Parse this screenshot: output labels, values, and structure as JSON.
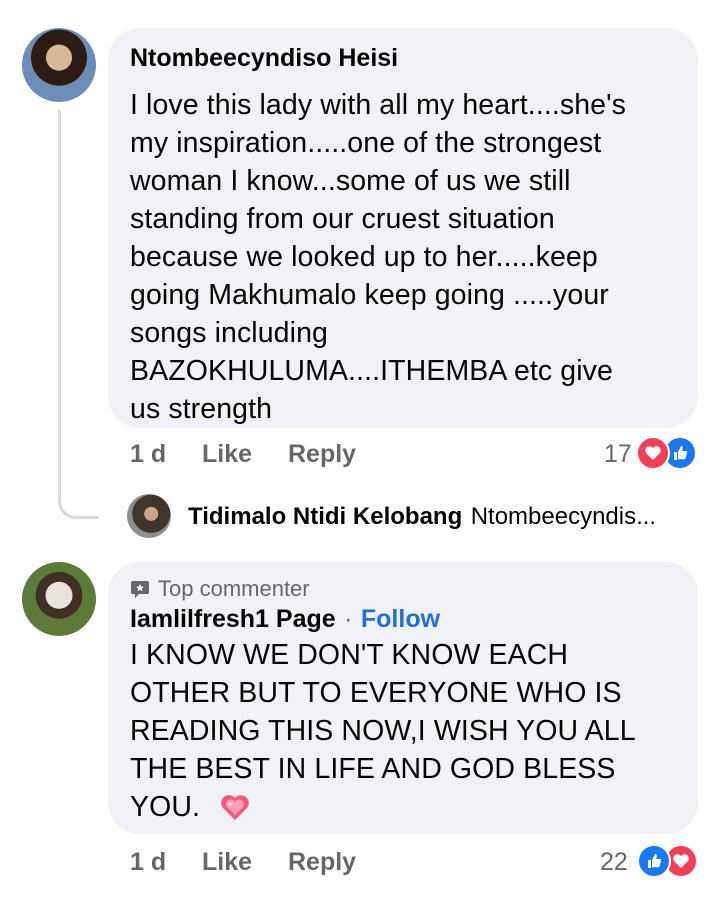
{
  "comments": [
    {
      "author": "Ntombeecyndiso Heisi",
      "lines": [
        "I love this lady with all my heart....she's",
        "my inspiration.....one of the strongest",
        "woman I know...some of us we still",
        "standing from our cruest situation",
        "because we looked up to her.....keep",
        "going Makhumalo keep going .....your",
        "songs including",
        "BAZOKHULUMA....ITHEMBA etc give",
        "us strength"
      ],
      "time": "1 d",
      "like_label": "Like",
      "reply_label": "Reply",
      "reaction_count": "17"
    },
    {
      "badge": "Top commenter",
      "author": "Iamlilfresh1 Page",
      "separator": "·",
      "follow_label": "Follow",
      "lines": [
        "I KNOW WE DON'T KNOW EACH",
        "OTHER BUT TO EVERYONE WHO IS",
        "READING THIS NOW,I WISH YOU ALL",
        "THE BEST IN LIFE AND GOD BLESS",
        "YOU."
      ],
      "time": "1 d",
      "like_label": "Like",
      "reply_label": "Reply",
      "reaction_count": "22"
    }
  ],
  "reply_preview": {
    "author": "Tidimalo Ntidi Kelobang",
    "snippet": "Ntombeecyndis..."
  },
  "colors": {
    "bubble": "#f0f2f5",
    "link_blue": "#216fdb",
    "like_blue": "#1877f2",
    "love_red": "#f33e58",
    "meta_gray": "#65676b"
  }
}
